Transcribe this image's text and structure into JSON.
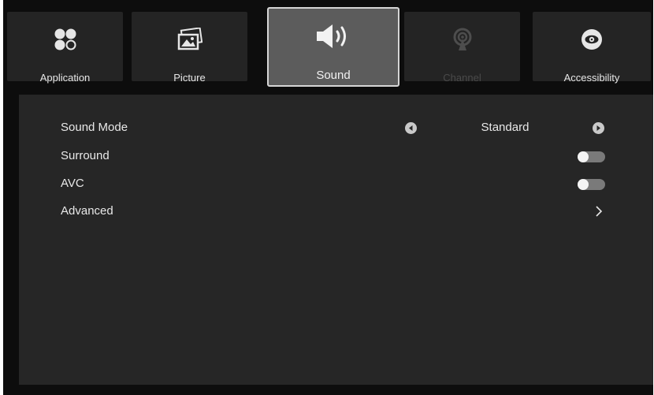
{
  "tabs": [
    {
      "label": "Application",
      "icon": "application-icon",
      "state": "normal"
    },
    {
      "label": "Picture",
      "icon": "picture-icon",
      "state": "normal"
    },
    {
      "label": "Sound",
      "icon": "speaker-icon",
      "state": "selected"
    },
    {
      "label": "Channel",
      "icon": "antenna-icon",
      "state": "disabled"
    },
    {
      "label": "Accessibility",
      "icon": "eye-icon",
      "state": "normal"
    }
  ],
  "settings": {
    "sound_mode": {
      "label": "Sound Mode",
      "value": "Standard"
    },
    "surround": {
      "label": "Surround",
      "enabled": false
    },
    "avc": {
      "label": "AVC",
      "enabled": false
    },
    "advanced": {
      "label": "Advanced"
    }
  },
  "colors": {
    "background": "#0d0d0d",
    "tab": "#242424",
    "tab_selected": "#5c5c5c",
    "panel": "#262626",
    "text": "#e8e8e8",
    "disabled_text": "#4a4a4a"
  }
}
